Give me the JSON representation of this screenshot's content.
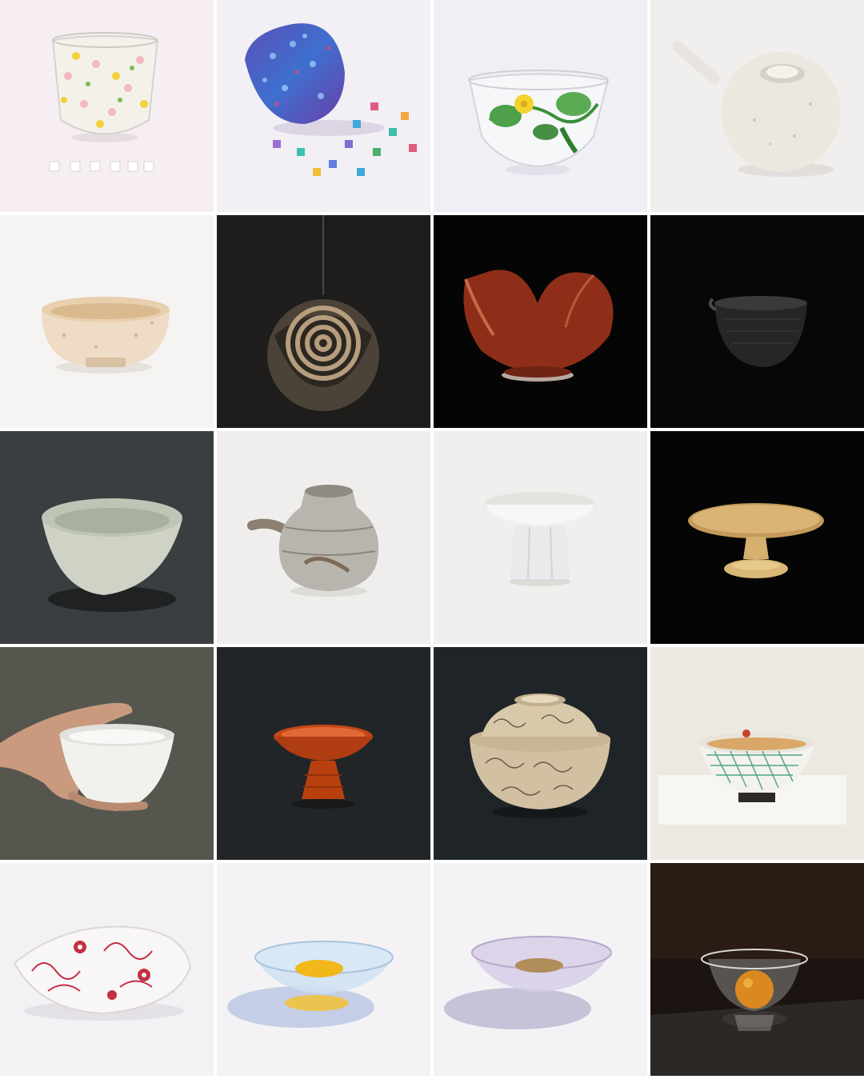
{
  "gallery": {
    "columns": 4,
    "rows": 5,
    "tiles": [
      {
        "subject": "flower-glass-cup",
        "background": "#f6eef2"
      },
      {
        "subject": "mosaic-glass-bowl",
        "background": "#f2f0f4"
      },
      {
        "subject": "cucumber-glass-cup",
        "background": "#f0eff5"
      },
      {
        "subject": "white-spouted-pot",
        "background": "#f1efee"
      },
      {
        "subject": "shino-tea-bowl",
        "background": "#f6f4f2"
      },
      {
        "subject": "hanging-incense-holder",
        "background": "#1e1d1c"
      },
      {
        "subject": "red-petal-cup",
        "background": "#050505"
      },
      {
        "subject": "black-lipped-bowl",
        "background": "#070707"
      },
      {
        "subject": "celadon-bowl",
        "background": "#3b3e40"
      },
      {
        "subject": "gray-spouted-jar",
        "background": "#efeeec"
      },
      {
        "subject": "white-stem-cup",
        "background": "#f0efee"
      },
      {
        "subject": "wooden-pedestal-dish",
        "background": "#050505"
      },
      {
        "subject": "hand-held-white-bowl",
        "background": "#55574f"
      },
      {
        "subject": "red-lacquer-stem-cup",
        "background": "#222528"
      },
      {
        "subject": "lidded-arabesque-bowl",
        "background": "#1f2428"
      },
      {
        "subject": "painted-porcelain-bowl",
        "background": "#ece8e2"
      },
      {
        "subject": "red-floral-glass-dish",
        "background": "#f2f1f3"
      },
      {
        "subject": "blue-glass-bowl",
        "background": "#f4f2f5"
      },
      {
        "subject": "lavender-glass-bowl",
        "background": "#f3f2f4"
      },
      {
        "subject": "glass-dessert-bowl",
        "background": "#1b1410"
      }
    ]
  }
}
